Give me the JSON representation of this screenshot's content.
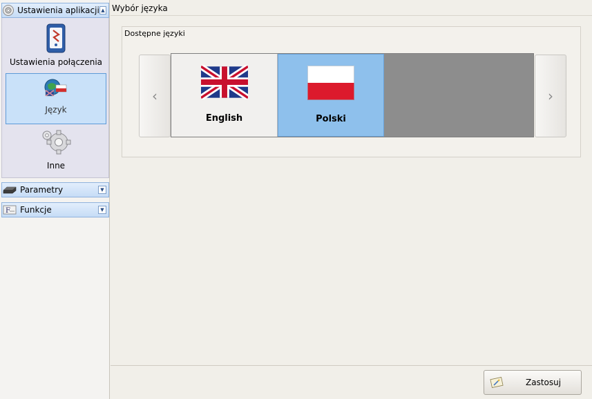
{
  "sidebar": {
    "app_settings": {
      "label": "Ustawienia aplikacji",
      "icon": "gear-small-icon",
      "state": "expanded"
    },
    "items": [
      {
        "label": "Ustawienia połączenia",
        "icon": "device-connection-icon"
      },
      {
        "label": "Język",
        "icon": "globe-flags-icon",
        "selected": true
      },
      {
        "label": "Inne",
        "icon": "gear-icon"
      }
    ],
    "parameters": {
      "label": "Parametry",
      "icon": "device-icon",
      "state": "collapsed"
    },
    "functions": {
      "label": "Funkcje",
      "icon": "function-icon",
      "state": "collapsed"
    }
  },
  "main": {
    "title": "Wybór języka",
    "group_title": "Dostępne języki",
    "scroll_left": "‹",
    "scroll_right": "›",
    "languages": [
      {
        "name": "English",
        "flag": "uk-flag-icon",
        "selected": false
      },
      {
        "name": "Polski",
        "flag": "poland-flag-icon",
        "selected": true
      }
    ]
  },
  "footer": {
    "apply_label": "Zastosuj",
    "apply_icon": "apply-icon"
  },
  "colors": {
    "selected_tile": "#8ec0ec",
    "selected_nav": "#c9e1f9",
    "header_blue": "#c6dcf6"
  }
}
